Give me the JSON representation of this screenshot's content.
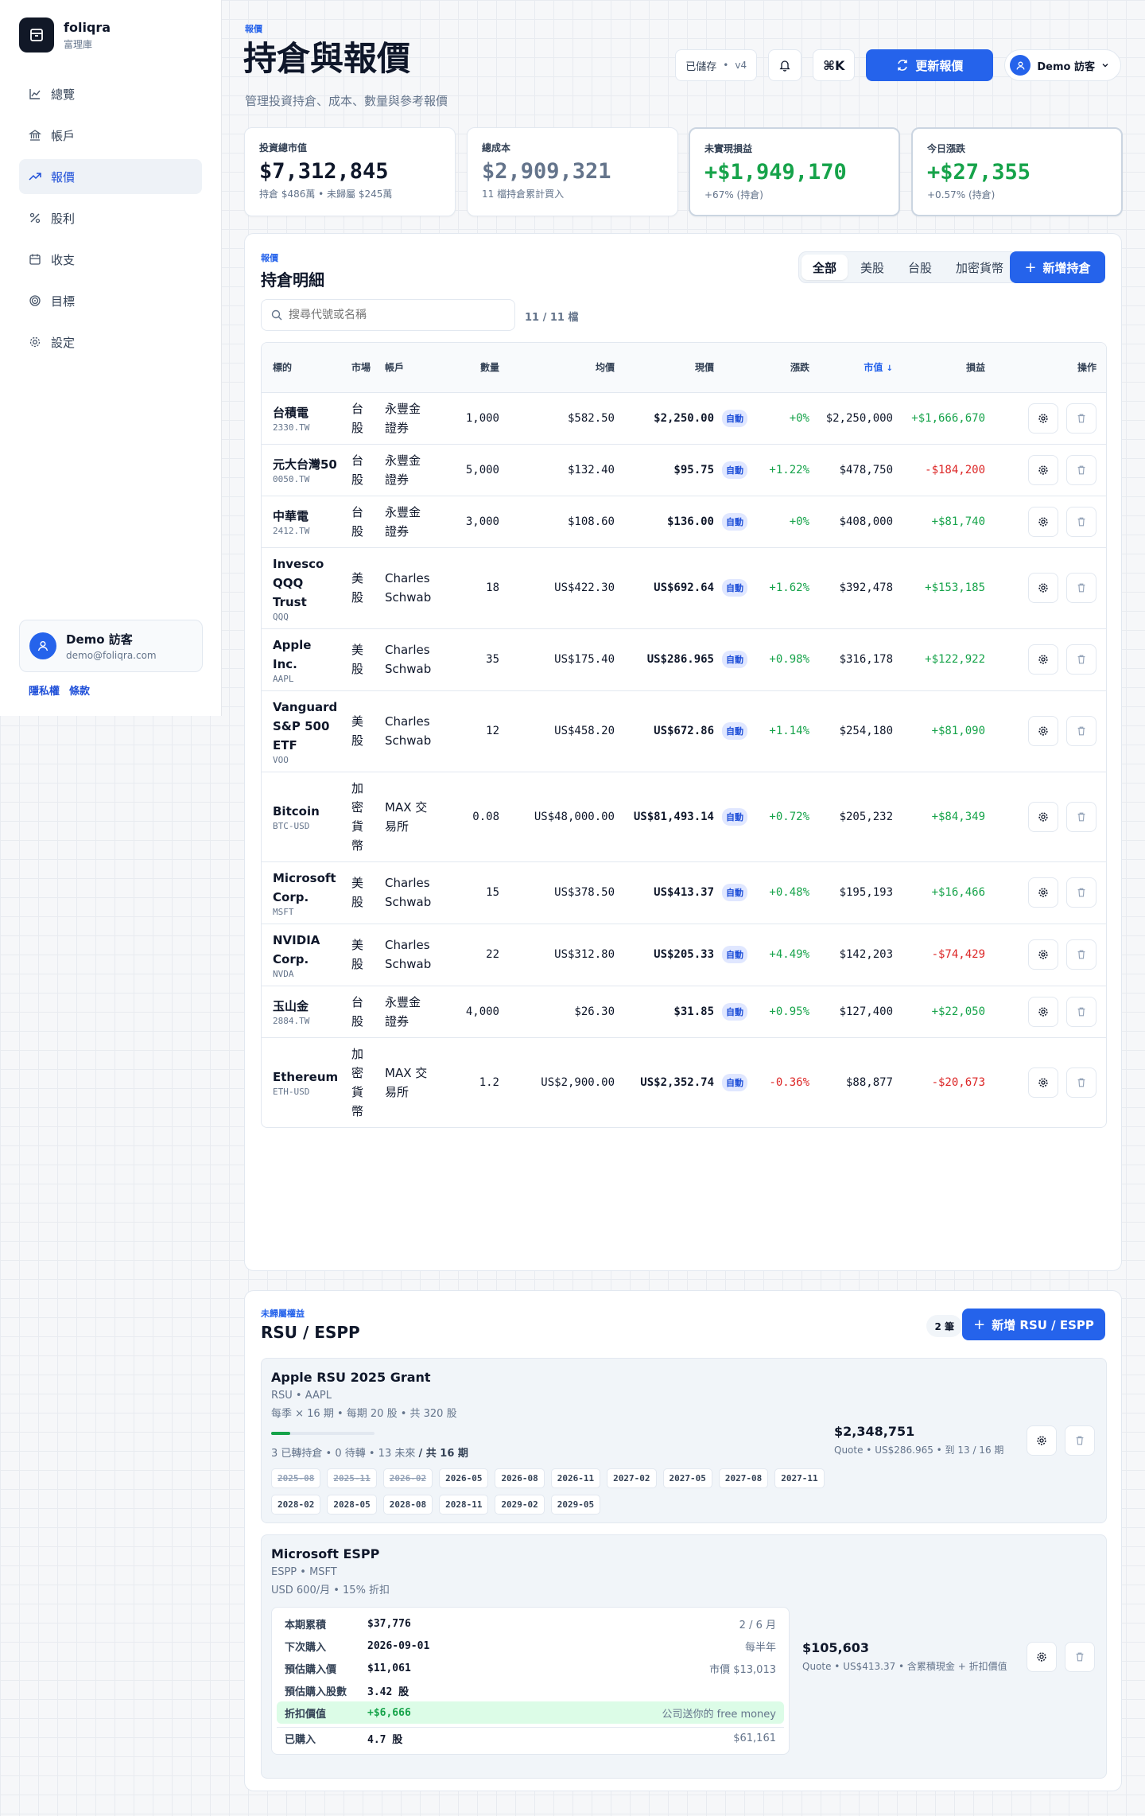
{
  "brand": {
    "name": "foliqra",
    "sub": "富理庫"
  },
  "nav": [
    {
      "label": "總覽",
      "icon": "chart-icon"
    },
    {
      "label": "帳戶",
      "icon": "bank-icon"
    },
    {
      "label": "報價",
      "icon": "trend-icon"
    },
    {
      "label": "股利",
      "icon": "percent-icon"
    },
    {
      "label": "收支",
      "icon": "calendar-icon"
    },
    {
      "label": "目標",
      "icon": "target-icon"
    },
    {
      "label": "設定",
      "icon": "gear-icon"
    }
  ],
  "user": {
    "name": "Demo 訪客",
    "email": "demo@foliqra.com"
  },
  "footer_links": {
    "privacy": "隱私權",
    "terms": "條款"
  },
  "header": {
    "eyebrow": "報價",
    "title": "持倉與報價",
    "subtitle": "管理投資持倉、成本、數量與參考報價",
    "saved": "已儲存",
    "version": "v4",
    "cmdk": "⌘K",
    "refresh": "更新報價",
    "account": "Demo 訪客"
  },
  "stats": [
    {
      "label": "投資總市值",
      "value": "$7,312,845",
      "sub": "持倉 $486萬 • 未歸屬 $245萬"
    },
    {
      "label": "總成本",
      "value": "$2,909,321",
      "sub": "11 檔持倉累計買入"
    },
    {
      "label": "未實現損益",
      "value": "+$1,949,170",
      "sub": "+67% (持倉)"
    },
    {
      "label": "今日漲跌",
      "value": "+$27,355",
      "sub": "+0.57% (持倉)"
    }
  ],
  "holdings": {
    "eyebrow": "報價",
    "title": "持倉明細",
    "tabs": [
      "全部",
      "美股",
      "台股",
      "加密貨幣"
    ],
    "add": "新增持倉",
    "search_placeholder": "搜尋代號或名稱",
    "count": "11 / 11 檔",
    "columns": {
      "symbol": "標的",
      "market": "市場",
      "account": "帳戶",
      "qty": "數量",
      "avg": "均價",
      "price": "現價",
      "change": "漲跌",
      "value": "市值",
      "pnl": "損益",
      "ops": "操作"
    },
    "auto_label": "自動",
    "rows": [
      {
        "name": "台積電",
        "code": "2330.TW",
        "market": "台股",
        "account": "永豐金證券",
        "qty": "1,000",
        "avg": "$582.50",
        "price": "$2,250.00",
        "change": "+0%",
        "value": "$2,250,000",
        "pnl": "+$1,666,670",
        "up": true
      },
      {
        "name": "元大台灣50",
        "code": "0050.TW",
        "market": "台股",
        "account": "永豐金證券",
        "qty": "5,000",
        "avg": "$132.40",
        "price": "$95.75",
        "change": "+1.22%",
        "value": "$478,750",
        "pnl": "-$184,200",
        "up": false
      },
      {
        "name": "中華電",
        "code": "2412.TW",
        "market": "台股",
        "account": "永豐金證券",
        "qty": "3,000",
        "avg": "$108.60",
        "price": "$136.00",
        "change": "+0%",
        "value": "$408,000",
        "pnl": "+$81,740",
        "up": true
      },
      {
        "name": "Invesco QQQ Trust",
        "code": "QQQ",
        "market": "美股",
        "account": "Charles Schwab",
        "qty": "18",
        "avg": "US$422.30",
        "price": "US$692.64",
        "change": "+1.62%",
        "value": "$392,478",
        "pnl": "+$153,185",
        "up": true
      },
      {
        "name": "Apple Inc.",
        "code": "AAPL",
        "market": "美股",
        "account": "Charles Schwab",
        "qty": "35",
        "avg": "US$175.40",
        "price": "US$286.965",
        "change": "+0.98%",
        "value": "$316,178",
        "pnl": "+$122,922",
        "up": true
      },
      {
        "name": "Vanguard S&P 500 ETF",
        "code": "VOO",
        "market": "美股",
        "account": "Charles Schwab",
        "qty": "12",
        "avg": "US$458.20",
        "price": "US$672.86",
        "change": "+1.14%",
        "value": "$254,180",
        "pnl": "+$81,090",
        "up": true
      },
      {
        "name": "Bitcoin",
        "code": "BTC-USD",
        "market": "加密貨幣",
        "account": "MAX 交易所",
        "qty": "0.08",
        "avg": "US$48,000.00",
        "price": "US$81,493.14",
        "change": "+0.72%",
        "value": "$205,232",
        "pnl": "+$84,349",
        "up": true
      },
      {
        "name": "Microsoft Corp.",
        "code": "MSFT",
        "market": "美股",
        "account": "Charles Schwab",
        "qty": "15",
        "avg": "US$378.50",
        "price": "US$413.37",
        "change": "+0.48%",
        "value": "$195,193",
        "pnl": "+$16,466",
        "up": true
      },
      {
        "name": "NVIDIA Corp.",
        "code": "NVDA",
        "market": "美股",
        "account": "Charles Schwab",
        "qty": "22",
        "avg": "US$312.80",
        "price": "US$205.33",
        "change": "+4.49%",
        "value": "$142,203",
        "pnl": "-$74,429",
        "up": false
      },
      {
        "name": "玉山金",
        "code": "2884.TW",
        "market": "台股",
        "account": "永豐金證券",
        "qty": "4,000",
        "avg": "$26.30",
        "price": "$31.85",
        "change": "+0.95%",
        "value": "$127,400",
        "pnl": "+$22,050",
        "up": true
      },
      {
        "name": "Ethereum",
        "code": "ETH-USD",
        "market": "加密貨幣",
        "account": "MAX 交易所",
        "qty": "1.2",
        "avg": "US$2,900.00",
        "price": "US$2,352.74",
        "change": "-0.36%",
        "value": "$88,877",
        "pnl": "-$20,673",
        "up": false,
        "chg_down": true
      }
    ]
  },
  "rsu": {
    "eyebrow": "未歸屬權益",
    "title": "RSU / ESPP",
    "count": "2 筆",
    "add": "新增 RSU / ESPP",
    "grant1": {
      "name": "Apple RSU 2025 Grant",
      "meta1": "RSU • AAPL",
      "meta2": "每季 × 16 期 • 每期 20 股 • 共 320 股",
      "progress": 0.1875,
      "status": "3 已轉持倉 • 0 待轉 • 13 未來",
      "total": "/ 共 16 期",
      "chips": [
        {
          "d": "2025-08",
          "done": true
        },
        {
          "d": "2025-11",
          "done": true
        },
        {
          "d": "2026-02",
          "done": true
        },
        {
          "d": "2026-05",
          "done": false
        },
        {
          "d": "2026-08",
          "done": false
        },
        {
          "d": "2026-11",
          "done": false
        },
        {
          "d": "2027-02",
          "done": false
        },
        {
          "d": "2027-05",
          "done": false
        },
        {
          "d": "2027-08",
          "done": false
        },
        {
          "d": "2027-11",
          "done": false
        },
        {
          "d": "2028-02",
          "done": false
        },
        {
          "d": "2028-05",
          "done": false
        },
        {
          "d": "2028-08",
          "done": false
        },
        {
          "d": "2028-11",
          "done": false
        },
        {
          "d": "2029-02",
          "done": false
        },
        {
          "d": "2029-05",
          "done": false
        }
      ],
      "value": "$2,348,751",
      "quote": "Quote • US$286.965 • 到 13 / 16 期"
    },
    "grant2": {
      "name": "Microsoft ESPP",
      "meta1": "ESPP • MSFT",
      "meta2": "USD 600/月 • 15% 折扣",
      "rows": [
        {
          "k": "本期累積",
          "v": "$37,776",
          "note": "2 / 6 月"
        },
        {
          "k": "下次購入",
          "v": "2026-09-01",
          "note": "每半年"
        },
        {
          "k": "預估購入價",
          "v": "$11,061",
          "note": "市價 $13,013"
        },
        {
          "k": "預估購入股數",
          "v": "3.42 股",
          "note": ""
        },
        {
          "k": "折扣價值",
          "v": "+$6,666",
          "note": "公司送你的 free money"
        },
        {
          "k": "已購入",
          "v": "4.7 股",
          "note": "$61,161"
        }
      ],
      "value": "$105,603",
      "quote": "Quote • US$413.37 • 含累積現金 + 折扣價值"
    }
  },
  "colors": {
    "accent": "#2563eb",
    "gain": "#16a34a",
    "loss": "#dc2626"
  }
}
